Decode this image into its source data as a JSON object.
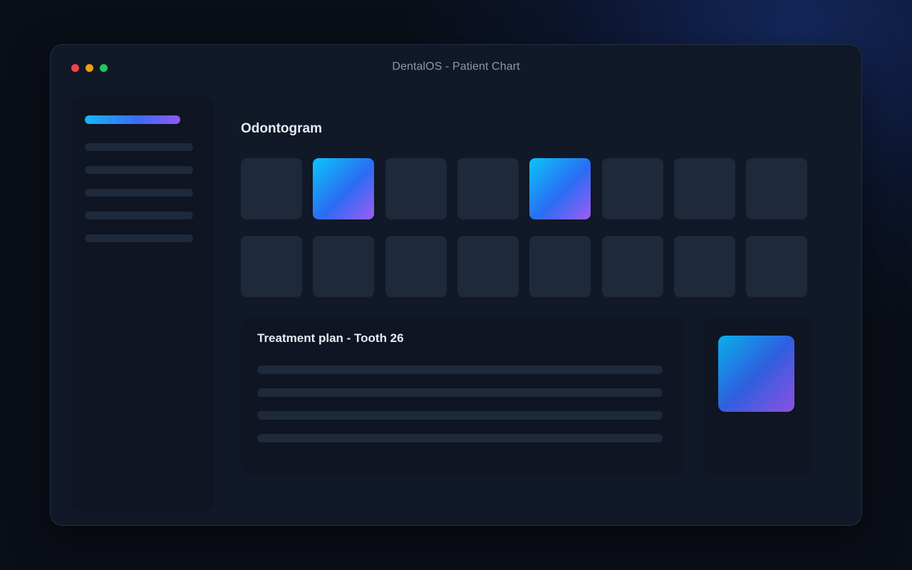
{
  "window": {
    "title": "DentalOS - Patient Chart"
  },
  "odontogram": {
    "heading": "Odontogram",
    "selected_color_start": "#0bc5fa",
    "selected_color_end": "#a05cf5",
    "tile_color": "#1e293b"
  },
  "treatment": {
    "title": "Treatment plan - Tooth 26"
  }
}
